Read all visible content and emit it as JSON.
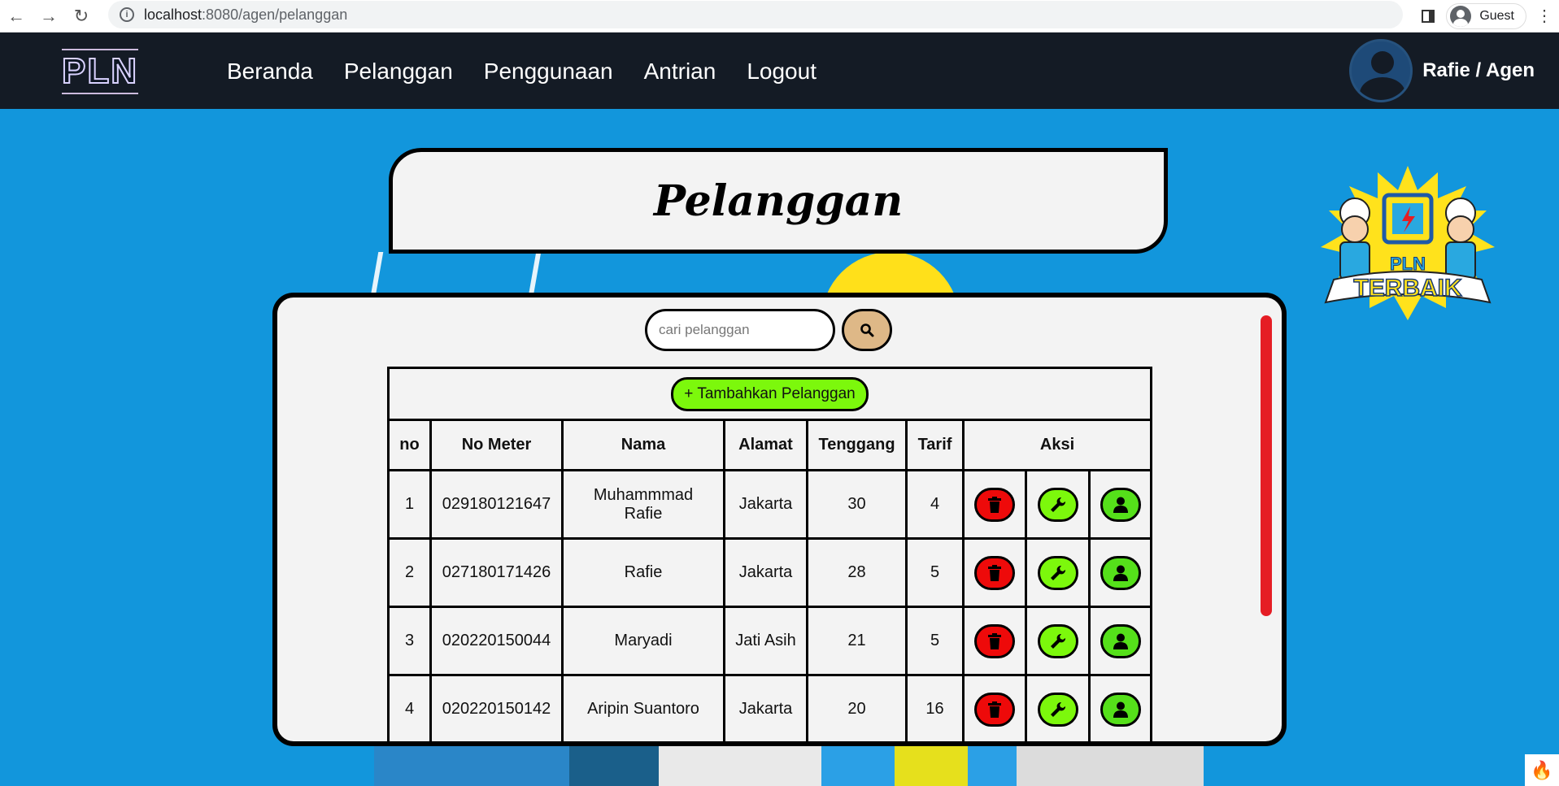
{
  "browser": {
    "url_host": "localhost",
    "url_path": ":8080/agen/pelanggan",
    "profile": "Guest"
  },
  "nav": {
    "logo": "PLN",
    "items": [
      "Beranda",
      "Pelanggan",
      "Penggunaan",
      "Antrian",
      "Logout"
    ],
    "user": "Rafie / Agen"
  },
  "page": {
    "title": "Pelanggan",
    "mascot_text": "PLN TERBAIK"
  },
  "search": {
    "placeholder": "cari pelanggan",
    "icon": "search-icon"
  },
  "table": {
    "add_button": "+ Tambahkan Pelanggan",
    "headers": [
      "no",
      "No Meter",
      "Nama",
      "Alamat",
      "Tenggang",
      "Tarif",
      "Aksi"
    ],
    "rows": [
      {
        "no": "1",
        "meter": "029180121647",
        "nama": "Muhammmad Rafie",
        "alamat": "Jakarta",
        "tenggang": "30",
        "tarif": "4"
      },
      {
        "no": "2",
        "meter": "027180171426",
        "nama": "Rafie",
        "alamat": "Jakarta",
        "tenggang": "28",
        "tarif": "5"
      },
      {
        "no": "3",
        "meter": "020220150044",
        "nama": "Maryadi",
        "alamat": "Jati Asih",
        "tenggang": "21",
        "tarif": "5"
      },
      {
        "no": "4",
        "meter": "020220150142",
        "nama": "Aripin Suantoro",
        "alamat": "Jakarta",
        "tenggang": "20",
        "tarif": "16"
      }
    ],
    "actions": [
      "trash-icon",
      "wrench-icon",
      "user-icon"
    ]
  },
  "colors": {
    "background": "#1296dc",
    "navbar": "#141b25",
    "delete": "#ee0a0a",
    "edit": "#7cf80c",
    "search_button": "#deb887",
    "scrollbar": "#e51d24"
  }
}
